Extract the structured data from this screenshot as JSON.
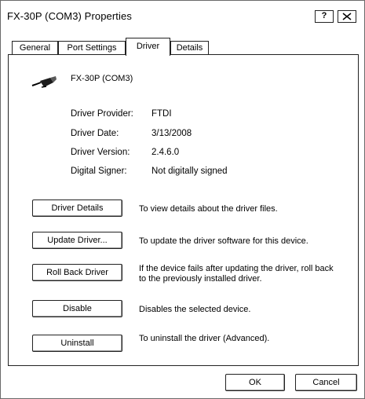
{
  "window": {
    "title": "FX-30P (COM3) Properties",
    "help_label": "?"
  },
  "tabs": [
    {
      "label": "General"
    },
    {
      "label": "Port Settings"
    },
    {
      "label": "Driver"
    },
    {
      "label": "Details"
    }
  ],
  "device": {
    "name": "FX-30P (COM3)",
    "icon": "usb-plug-icon"
  },
  "info": [
    {
      "label": "Driver Provider:",
      "value": "FTDI"
    },
    {
      "label": "Driver Date:",
      "value": "3/13/2008"
    },
    {
      "label": "Driver Version:",
      "value": "2.4.6.0"
    },
    {
      "label": "Digital Signer:",
      "value": "Not digitally signed"
    }
  ],
  "actions": [
    {
      "label": "Driver Details",
      "description": "To view details about the driver files."
    },
    {
      "label": "Update Driver...",
      "description": "To update the driver software for this device."
    },
    {
      "label": "Roll Back Driver",
      "description": "If the device fails after updating the driver, roll back to the previously installed driver."
    },
    {
      "label": "Disable",
      "description": "Disables the selected device."
    },
    {
      "label": "Uninstall",
      "description": "To uninstall the driver (Advanced)."
    }
  ],
  "footer": {
    "ok_label": "OK",
    "cancel_label": "Cancel"
  }
}
